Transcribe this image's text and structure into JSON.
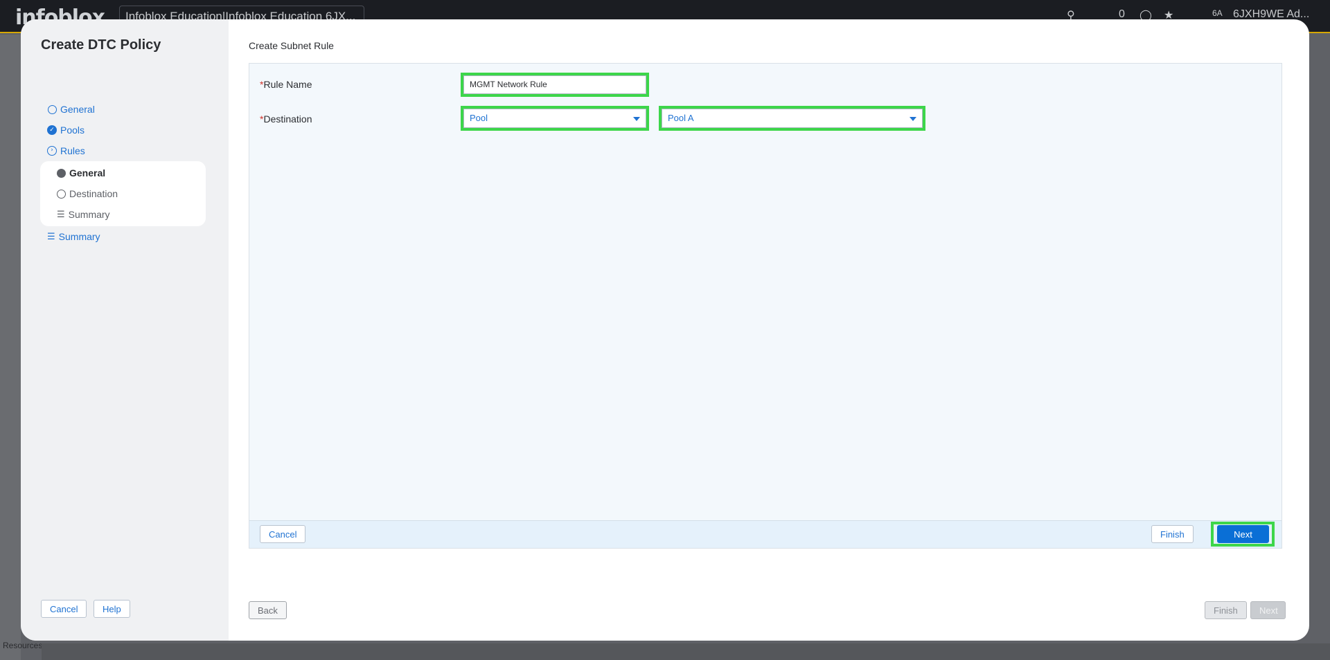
{
  "app": {
    "logo": "infoblox",
    "org_selector": "Infoblox Education|Infoblox Education 6JX...",
    "notifications_count": "0",
    "avatar_initials": "6A",
    "account": "6JXH9WE Ad...",
    "rail_bottom_label": "Resources"
  },
  "modal": {
    "title": "Create DTC Policy",
    "steps": [
      {
        "label": "General"
      },
      {
        "label": "Pools"
      },
      {
        "label": "Rules"
      },
      {
        "label": "Summary"
      }
    ],
    "substeps": [
      {
        "label": "General"
      },
      {
        "label": "Destination"
      },
      {
        "label": "Summary"
      }
    ],
    "cancel_label": "Cancel",
    "help_label": "Help",
    "back_label": "Back",
    "finish_label": "Finish",
    "next_label": "Next"
  },
  "subnet_rule": {
    "title": "Create Subnet Rule",
    "required_mark": "*",
    "rule_name_label": "Rule Name",
    "rule_name_value": "MGMT Network Rule",
    "destination_label": "Destination",
    "destination_type": "Pool",
    "destination_pool": "Pool A",
    "cancel_label": "Cancel",
    "finish_label": "Finish",
    "next_label": "Next"
  },
  "colors": {
    "accent": "#1f72d2",
    "primary_button": "#0a6fd6",
    "highlight": "#3dd64a",
    "required": "#d0342c"
  }
}
